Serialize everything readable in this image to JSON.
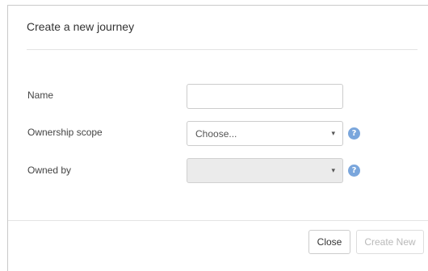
{
  "dialog": {
    "title": "Create a new journey"
  },
  "form": {
    "name": {
      "label": "Name",
      "value": ""
    },
    "ownership_scope": {
      "label": "Ownership scope",
      "selected": "Choose...",
      "help_icon": "question-mark-icon"
    },
    "owned_by": {
      "label": "Owned by",
      "selected": "",
      "disabled": true,
      "help_icon": "question-mark-icon"
    }
  },
  "footer": {
    "close_label": "Close",
    "create_label": "Create New"
  },
  "icons": {
    "caret": "▾",
    "help": "?"
  },
  "colors": {
    "help_icon": "#7aa6dc",
    "disabled_select": "#ebebeb",
    "disabled_button_text": "#b9b9b9"
  }
}
